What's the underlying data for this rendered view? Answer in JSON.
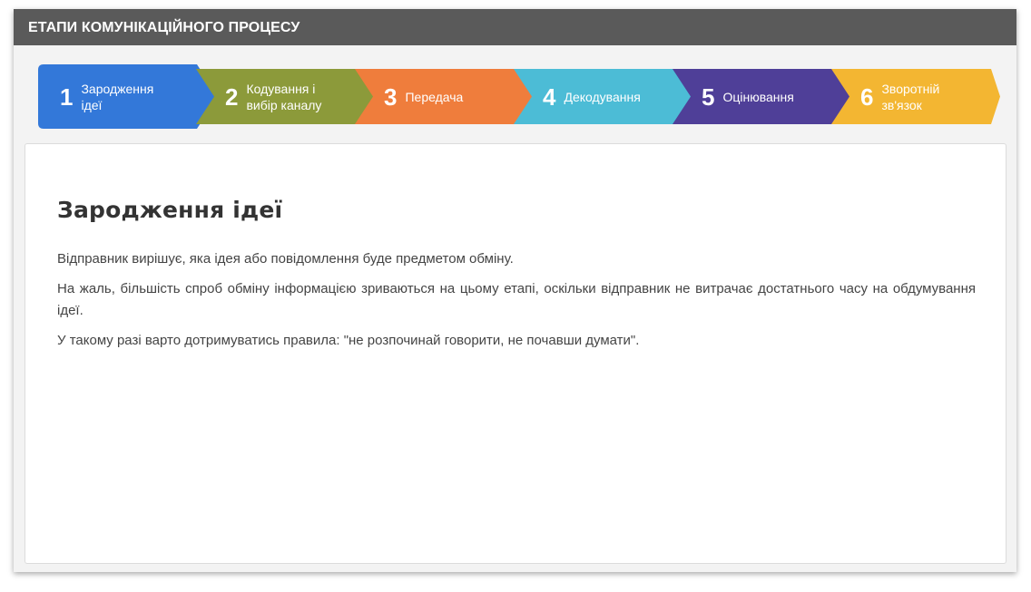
{
  "header": {
    "title": "ЕТАПИ КОМУНІКАЦІЙНОГО ПРОЦЕСУ"
  },
  "steps": [
    {
      "num": "1",
      "label": "Зародження ідеї",
      "color": "#3378d9",
      "active": true
    },
    {
      "num": "2",
      "label": "Кодування і вибір каналу",
      "color": "#8c9a3a"
    },
    {
      "num": "3",
      "label": "Передача",
      "color": "#ef7d3c"
    },
    {
      "num": "4",
      "label": "Декодування",
      "color": "#4cbcd6"
    },
    {
      "num": "5",
      "label": "Оцінювання",
      "color": "#4f3f98"
    },
    {
      "num": "6",
      "label": "Зворотній зв'язок",
      "color": "#f3b632"
    }
  ],
  "content": {
    "title": "Зародження ідеї",
    "paragraphs": [
      "Відправник вирішує, яка ідея або повідомлення буде предметом обміну.",
      "На жаль, більшість спроб обміну інформацією зриваються на цьому етапі, оскільки відправник не витрачає достатнього часу на обдумування ідеї.",
      "У такому разі варто дотримуватись правила: \"не розпочинай говорити, не почавши думати\"."
    ]
  }
}
